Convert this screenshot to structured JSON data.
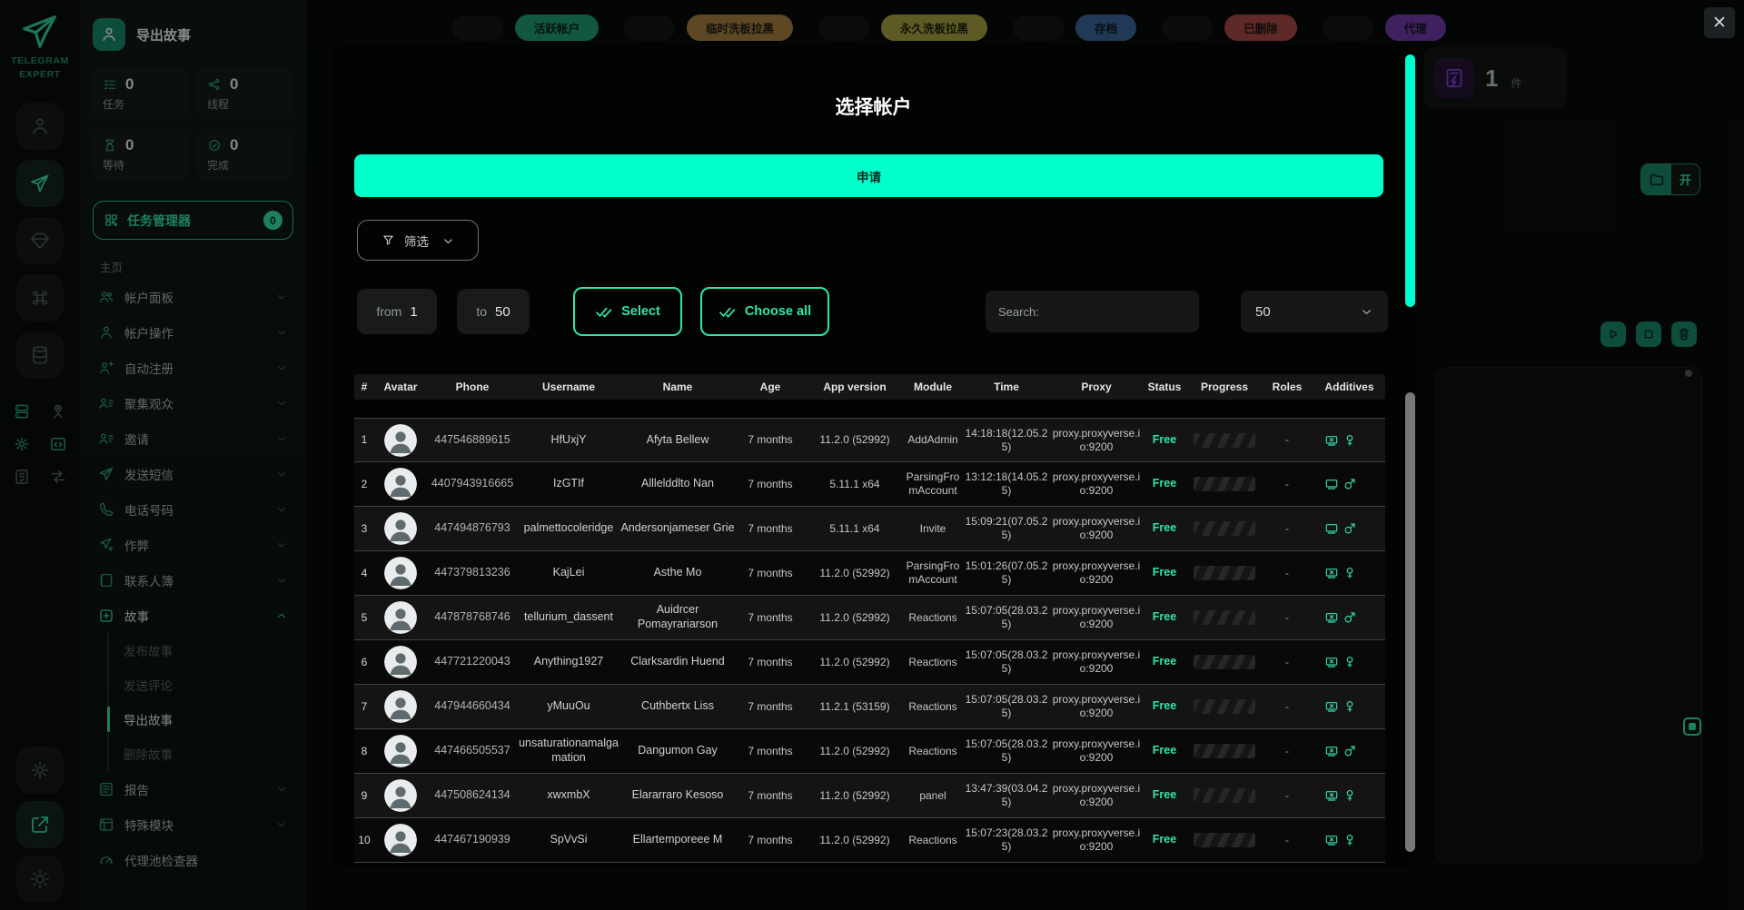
{
  "colors": {
    "accent": "#2ee6a8",
    "bright": "#00ffcb",
    "button_teal": "#17866b",
    "purple": "#7a3bd0"
  },
  "rail": {
    "brand_line1": "TELEGRAM",
    "brand_line2": "EXPERT",
    "nav": [
      {
        "icon": "person",
        "active": false
      },
      {
        "icon": "plane",
        "active": true
      },
      {
        "icon": "diamond",
        "active": false
      },
      {
        "icon": "command",
        "active": false
      },
      {
        "icon": "database",
        "active": false
      }
    ],
    "tools": [
      {
        "icon": "server",
        "teal": true
      },
      {
        "icon": "person-cam",
        "teal": false
      },
      {
        "icon": "gear",
        "teal": true
      },
      {
        "icon": "code-window",
        "teal": true
      },
      {
        "icon": "note-check",
        "teal": false
      },
      {
        "icon": "swap",
        "teal": false
      }
    ],
    "bottom": [
      {
        "icon": "gear",
        "active": false
      },
      {
        "icon": "external-link",
        "active": true
      },
      {
        "icon": "sun",
        "active": false
      }
    ]
  },
  "header": {
    "title": "导出故事"
  },
  "stats": [
    {
      "icon": "tasks",
      "value": "0",
      "label": "任务"
    },
    {
      "icon": "threads",
      "value": "0",
      "label": "线程"
    },
    {
      "icon": "hourglass",
      "value": "0",
      "label": "等待"
    },
    {
      "icon": "check-circle",
      "value": "0",
      "label": "完成"
    }
  ],
  "task_manager": {
    "label": "任务管理器",
    "count": "0",
    "icon": "qr-grid"
  },
  "menu": {
    "section": "主页",
    "items": [
      {
        "label": "帐户面板",
        "icon": "users"
      },
      {
        "label": "帐户操作",
        "icon": "person"
      },
      {
        "label": "自动注册",
        "icon": "person-plus"
      },
      {
        "label": "聚集观众",
        "icon": "person-list"
      },
      {
        "label": "邀请",
        "icon": "person-list"
      },
      {
        "label": "发送短信",
        "icon": "plane"
      },
      {
        "label": "电话号码",
        "icon": "phone"
      },
      {
        "label": "作弊",
        "icon": "plane-plus"
      },
      {
        "label": "联系人簿",
        "icon": "book"
      },
      {
        "label": "故事",
        "icon": "plus-square",
        "expanded": true
      }
    ],
    "stories_sub": [
      {
        "label": "发布故事",
        "active": false
      },
      {
        "label": "发送评论",
        "active": false
      },
      {
        "label": "导出故事",
        "active": true
      },
      {
        "label": "删除故事",
        "active": false
      }
    ],
    "items_after": [
      {
        "label": "报告",
        "icon": "report"
      },
      {
        "label": "特殊模块",
        "icon": "modules"
      },
      {
        "label": "代理池检查器",
        "icon": "gauge",
        "no_chevron": true
      }
    ]
  },
  "top_badges": [
    {
      "label": "活跃帐户",
      "bg": "#1c9a74"
    },
    {
      "label": "临时洗板拉黑",
      "bg": "#a87f3c"
    },
    {
      "label": "永久洗板拉黑",
      "bg": "#a89e3c"
    },
    {
      "label": "存档",
      "bg": "#3a639a"
    },
    {
      "label": "已删除",
      "bg": "#a84642"
    },
    {
      "label": "代理",
      "bg": "#6d37a8"
    }
  ],
  "right_panel": {
    "files_value": "1",
    "files_unit": "件",
    "toggle_label": "开"
  },
  "window": {
    "close": "✕"
  },
  "modal": {
    "title": "选择帐户",
    "apply": "申请",
    "filter": "筛选",
    "range": {
      "from_label": "from",
      "from_value": "1",
      "to_label": "to",
      "to_value": "50"
    },
    "select": "Select",
    "choose_all": "Choose all",
    "search_placeholder": "Search:",
    "page_size": "50",
    "table": {
      "columns": [
        "#",
        "Avatar",
        "Phone",
        "Username",
        "Name",
        "Age",
        "App version",
        "Module",
        "Time",
        "Proxy",
        "Status",
        "Progress",
        "Roles",
        "Additives"
      ],
      "rows": [
        {
          "n": "1",
          "phone": "447546889615",
          "username": "HfUxjY",
          "name": "Afyta Bellew",
          "age": "7 months",
          "app": "11.2.0 (52992)",
          "module": "AddAdmin",
          "time": "14:18:18(12.05.25)",
          "proxy": "proxy.proxyverse.io:9200",
          "status": "Free",
          "roles": "-",
          "additives": [
            "monitor-x",
            "female",
            "key"
          ]
        },
        {
          "n": "2",
          "phone": "4407943916665",
          "username": "IzGTIf",
          "name": "Alllelddlto Nan",
          "age": "7 months",
          "app": "5.11.1 x64",
          "module": "ParsingFromAccount",
          "time": "13:12:18(14.05.25)",
          "proxy": "proxy.proxyverse.io:9200",
          "status": "Free",
          "roles": "-",
          "additives": [
            "monitor",
            "male",
            "key"
          ]
        },
        {
          "n": "3",
          "phone": "447494876793",
          "username": "palmettocoleridge",
          "name": "Andersonjameser Grie",
          "age": "7 months",
          "app": "5.11.1 x64",
          "module": "Invite",
          "time": "15:09:21(07.05.25)",
          "proxy": "proxy.proxyverse.io:9200",
          "status": "Free",
          "roles": "-",
          "additives": [
            "monitor",
            "male",
            "key"
          ]
        },
        {
          "n": "4",
          "phone": "447379813236",
          "username": "KajLei",
          "name": "Asthe Mo",
          "age": "7 months",
          "app": "11.2.0 (52992)",
          "module": "ParsingFromAccount",
          "time": "15:01:26(07.05.25)",
          "proxy": "proxy.proxyverse.io:9200",
          "status": "Free",
          "roles": "-",
          "additives": [
            "monitor-x",
            "female",
            "key"
          ]
        },
        {
          "n": "5",
          "phone": "447878768746",
          "username": "tellurium_dassent",
          "name": "Auidrcer Pomayrariarson",
          "age": "7 months",
          "app": "11.2.0 (52992)",
          "module": "Reactions",
          "time": "15:07:05(28.03.25)",
          "proxy": "proxy.proxyverse.io:9200",
          "status": "Free",
          "roles": "-",
          "additives": [
            "monitor-x",
            "male",
            "key"
          ]
        },
        {
          "n": "6",
          "phone": "447721220043",
          "username": "Anything1927",
          "name": "Clarksardin Huend",
          "age": "7 months",
          "app": "11.2.0 (52992)",
          "module": "Reactions",
          "time": "15:07:05(28.03.25)",
          "proxy": "proxy.proxyverse.io:9200",
          "status": "Free",
          "roles": "-",
          "additives": [
            "monitor-x",
            "female",
            "key"
          ]
        },
        {
          "n": "7",
          "phone": "447944660434",
          "username": "yMuuOu",
          "name": "Cuthbertx Liss",
          "age": "7 months",
          "app": "11.2.1 (53159)",
          "module": "Reactions",
          "time": "15:07:05(28.03.25)",
          "proxy": "proxy.proxyverse.io:9200",
          "status": "Free",
          "roles": "-",
          "additives": [
            "monitor-x",
            "female",
            "key"
          ]
        },
        {
          "n": "8",
          "phone": "447466505537",
          "username": "unsaturationamalgamation",
          "name": "Dangumon Gay",
          "age": "7 months",
          "app": "11.2.0 (52992)",
          "module": "Reactions",
          "time": "15:07:05(28.03.25)",
          "proxy": "proxy.proxyverse.io:9200",
          "status": "Free",
          "roles": "-",
          "additives": [
            "monitor-x",
            "male",
            "key"
          ]
        },
        {
          "n": "9",
          "phone": "447508624134",
          "username": "xwxmbX",
          "name": "Elararraro Kesoso",
          "age": "7 months",
          "app": "11.2.0 (52992)",
          "module": "panel",
          "time": "13:47:39(03.04.25)",
          "proxy": "proxy.proxyverse.io:9200",
          "status": "Free",
          "roles": "-",
          "additives": [
            "monitor-x",
            "female",
            "key"
          ]
        },
        {
          "n": "10",
          "phone": "447467190939",
          "username": "SpVvSi",
          "name": "Ellartemporeee M",
          "age": "7 months",
          "app": "11.2.0 (52992)",
          "module": "Reactions",
          "time": "15:07:23(28.03.25)",
          "proxy": "proxy.proxyverse.io:9200",
          "status": "Free",
          "roles": "-",
          "additives": [
            "monitor-x",
            "female",
            "key"
          ]
        }
      ]
    }
  }
}
